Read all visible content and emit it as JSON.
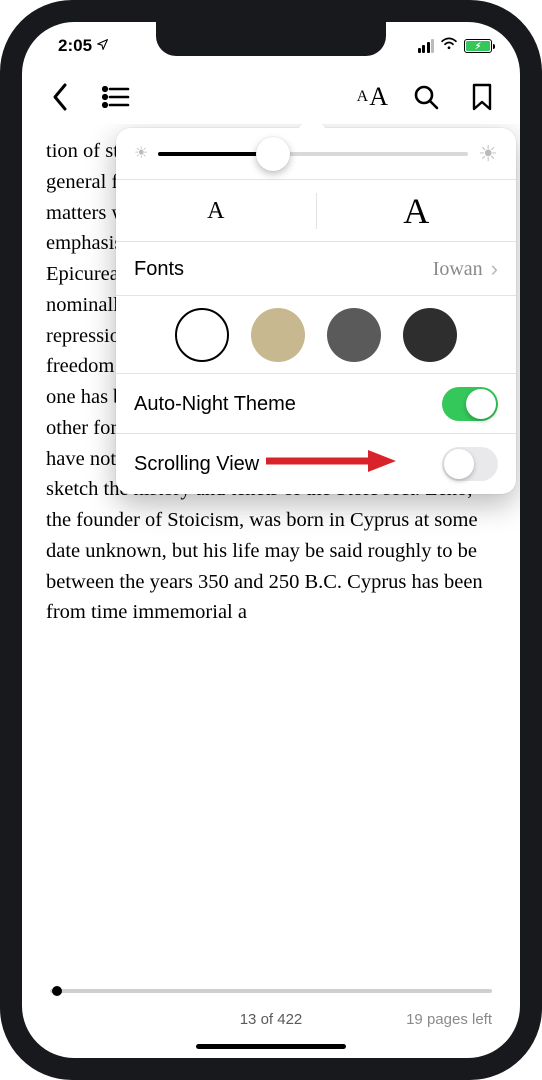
{
  "status": {
    "time": "2:05",
    "battery_icon": "⚡︎"
  },
  "toolbar": {
    "back_icon": "chevron-left",
    "contents_icon": "list",
    "appearance_icon": "AA",
    "search_icon": "magnifier",
    "bookmark_icon": "bookmark"
  },
  "popover": {
    "brightness_value": 0.37,
    "text_small": "A",
    "text_large": "A",
    "fonts_label": "Fonts",
    "fonts_value": "Iowan",
    "themes": [
      "white",
      "sepia",
      "gray",
      "black"
    ],
    "theme_selected": "white",
    "auto_night_label": "Auto-Night Theme",
    "auto_night_on": true,
    "scrolling_label": "Scrolling View",
    "scrolling_on": false
  },
  "book_text": "tion of stoicism and its principal importance, with the general facts and certain grammatical or verbal matters were set forth by the Greeks. The fundamental emphasis on the division between Stoicism and Epicureanism. The ideal set before each was nominally much the same. The Stoics aspired to the repression of all emotion, and the Epicureans to freedom from all disturbance; yet in the upshot the one has become a synonym of stubborn endurance, the other for unbridled licence. With Epicureanism we have nothing to do now; but it will be worth while to sketch the history and tenets of the Stoic sect. Zeno, the founder of Stoicism, was born in Cyprus at some date unknown, but his life may be said roughly to be between the years 350 and 250 B.C. Cyprus has been from time immemorial a",
  "footer": {
    "page_position": "13 of 422",
    "pages_left": "19 pages left",
    "progress": 0.015
  }
}
